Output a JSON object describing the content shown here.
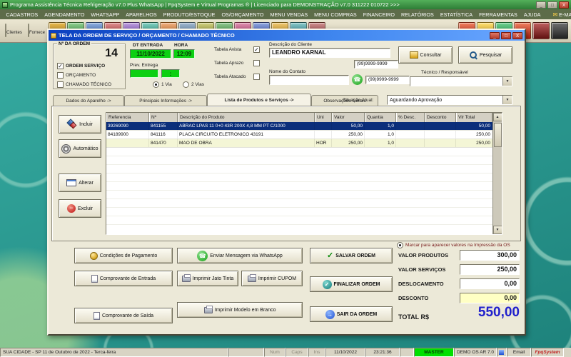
{
  "colors": {
    "desktop_teal": "#1E837C",
    "field_green": "#0CD012",
    "selected_row": "#0B2E7B",
    "total_blue": "#2121CC",
    "master_green": "#00DF00",
    "desconto_yellow": "#FFFFC4"
  },
  "icons": {
    "check": "✓",
    "phone": "☎",
    "envelope": "✉",
    "arrow_right": "→",
    "minus": "−",
    "up": "▲",
    "down": "▼"
  },
  "titlebar": {
    "title": "Programa Assistência Técnica Refrigeração v7.0 Plus WhatsApp | FpqSystem e Virtual Programas ® | Licenciado para  DEMONSTRAÇÃO v7.0 311222 010722 >>>",
    "min": "_",
    "max": "□",
    "close": "X"
  },
  "menu": {
    "items": [
      "CADASTROS",
      "AGENDAMENTO",
      "WHATSAPP",
      "APARELHOS",
      "PRODUTO/ESTOQUE",
      "OS/ORÇAMENTO",
      "MENU VENDAS",
      "MENU COMPRAS",
      "FINANCEIRO",
      "RELATÓRIOS",
      "ESTATÍSTICA",
      "FERRAMENTAS",
      "AJUDA",
      "E-MAIL"
    ]
  },
  "toolbar": {
    "labels": [
      "Clientes",
      "Fornece"
    ]
  },
  "window": {
    "title": "TELA DA ORDEM DE SERVIÇO / ORÇAMENTO / CHAMADO TÉCNICO",
    "min": "_",
    "max": "□",
    "close": "X"
  },
  "order": {
    "numero_label": "Nº DA ORDEM",
    "numero": "14",
    "dt_label": "DT ENTRADA",
    "hora_label": "HORA",
    "dt": "11/10/2022",
    "hora": "12:09",
    "prev_label": "Prev. Entrega",
    "prev_time": ":",
    "chk_ordem": "ORDEM SERVIÇO",
    "chk_orc": "ORÇAMENTO",
    "chk_chamado": "CHAMADO TÉCNICO",
    "via1": "1 Via",
    "via2": "2 Vias",
    "tab_avista": "Tabela Avista",
    "tab_aprazo": "Tabela Aprazo",
    "tab_atacado": "Tabela Atacado",
    "cliente_label": "Descrição do Cliente",
    "cliente": "LEANDRO KARNAL",
    "fone1": "(99)9999-9999",
    "contato_label": "Nome do Contato",
    "fone2": "(99)9999-9999",
    "btn_consultar": "Consultar",
    "btn_pesquisar": "Pesquisar",
    "tecnico_label": "Técnico / Responsável"
  },
  "tabs": {
    "t0": "Dados do Aparelho ->",
    "t1": "Principais Informações ->",
    "t2": "Lista de Produtos e Serviços ->",
    "t3": "Observações Gerais"
  },
  "situacao": {
    "label": "Situação Atual:",
    "value": "Aguardando Aprovação"
  },
  "side": {
    "incluir": "Incluir",
    "automatico": "Automático",
    "alterar": "Alterar",
    "excluir": "Excluir"
  },
  "table": {
    "columns": [
      "Referencia",
      "Nº",
      "Descrição do Produto",
      "Uni",
      "Valor",
      "Quantia",
      "% Desc.",
      "Desconto",
      "Vlr Total"
    ],
    "rows": [
      [
        "39269090",
        "841155",
        "ABRAC LPAS 11 0+0 43R 200X 4,8 MM PT C/1000",
        "",
        "50,00",
        "1,0",
        "",
        "",
        "50,00"
      ],
      [
        "84189900",
        "841116",
        "PLACA CIRCUITO ELETRONICO 43191",
        "",
        "250,00",
        "1,0",
        "",
        "",
        "250,00"
      ],
      [
        "",
        "841470",
        "MAO DE OBRA",
        "HOR",
        "250,00",
        "1,0",
        "",
        "",
        "250,00"
      ]
    ]
  },
  "actions": {
    "cond": "Condições de Pagamento",
    "entrada": "Comprovante de Entrada",
    "saida": "Comprovante de Saída",
    "whats": "Enviar Mensagem via WhatsApp",
    "jato": "Imprimir Jato Tinta",
    "cupom": "Imprimir CUPOM",
    "modelo": "Imprimir Modelo em Branco",
    "salvar": "SALVAR ORDEM",
    "finalizar": "FINALIZAR ORDEM",
    "sair": "SAIR DA ORDEM"
  },
  "totals": {
    "note": "Marcar para aparecer valores na Impressão da OS",
    "l0": "VALOR PRODUTOS",
    "v0": "300,00",
    "l1": "VALOR SERVIÇOS",
    "v1": "250,00",
    "l2": "DESLOCAMENTO",
    "v2": "0,00",
    "l3": "DESCONTO",
    "v3": "0,00",
    "total_label": "TOTAL R$",
    "total": "550,00"
  },
  "status": {
    "location": "SUA CIDADE - SP 11 de Outubro de 2022 - Terca-feira",
    "num": "Num",
    "caps": "Caps",
    "ins": "Ins",
    "date": "11/10/2022",
    "time": "23:21:36",
    "user": "MASTER",
    "build": "DEMO OS AR 7.0",
    "email": "Email",
    "brand": "FpqSystem"
  }
}
